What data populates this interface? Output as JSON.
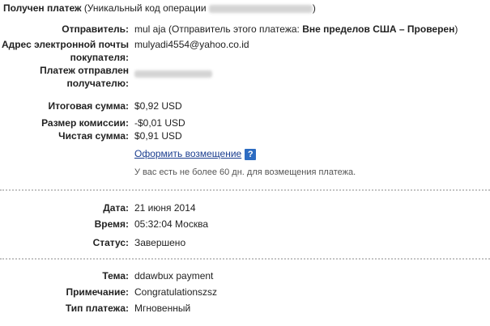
{
  "header": {
    "title": "Получен платеж",
    "code_label": "(Уникальный код операции",
    "code_close": ")"
  },
  "details": {
    "sender_label": "Отправитель:",
    "sender_name": "mul aja",
    "sender_status_prefix": "(Отправитель этого платежа:",
    "sender_status": "Вне пределов США – Проверен",
    "sender_status_suffix": ")",
    "buyer_email_label_1": "Адрес электронной почты",
    "buyer_email_label_2": "покупателя:",
    "buyer_email": "mulyadi4554@yahoo.co.id",
    "sent_to_label_1": "Платеж отправлен",
    "sent_to_label_2": "получателю:"
  },
  "amounts": {
    "total_label": "Итоговая сумма:",
    "total": "$0,92 USD",
    "fee_label": "Размер комиссии:",
    "fee": "-$0,01 USD",
    "net_label": "Чистая сумма:",
    "net": "$0,91 USD",
    "refund_link": "Оформить возмещение",
    "help_icon": "?",
    "refund_note": "У вас есть не более 60 дн. для возмещения платежа."
  },
  "status": {
    "date_label": "Дата:",
    "date": "21 июня 2014",
    "time_label": "Время:",
    "time": "05:32:04 Москва",
    "status_label": "Статус:",
    "status": "Завершено"
  },
  "memo": {
    "subject_label": "Тема:",
    "subject": "ddawbux payment",
    "note_label": "Примечание:",
    "note": "Congratulationszsz",
    "type_label": "Тип платежа:",
    "type": "Мгновенный"
  },
  "colors": {
    "link": "#1a3d8f",
    "help_icon_bg": "#2d6cc2",
    "separator": "#c4c4c4"
  }
}
